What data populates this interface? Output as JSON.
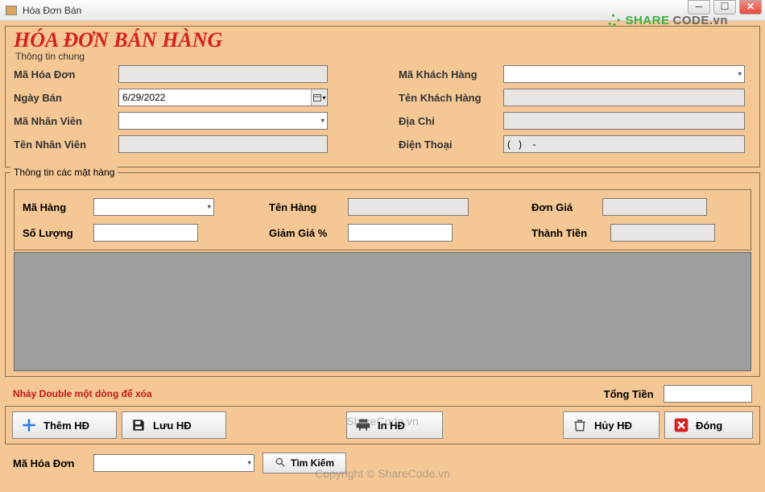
{
  "window": {
    "title": "Hóa Đơn Bán"
  },
  "brand": {
    "green": "SHARE",
    "gray": "CODE.vn"
  },
  "header": {
    "title": "HÓA ĐƠN BÁN HÀNG",
    "group_legend": "Thông tin chung"
  },
  "general": {
    "invoice_id_label": "Mã Hóa Đơn",
    "invoice_id_value": "",
    "sale_date_label": "Ngày Bán",
    "sale_date_value": "6/29/2022",
    "employee_id_label": "Mã Nhân Viên",
    "employee_id_value": "",
    "employee_name_label": "Tên Nhân Viên",
    "employee_name_value": "",
    "customer_id_label": "Mã Khách Hàng",
    "customer_id_value": "",
    "customer_name_label": "Tên Khách Hàng",
    "customer_name_value": "",
    "address_label": "Địa Chỉ",
    "address_value": "",
    "phone_label": "Điện Thoại",
    "phone_value": "(   )    -"
  },
  "items_group": {
    "legend": "Thông tin các mặt hàng",
    "product_id_label": "Mã Hàng",
    "product_id_value": "",
    "product_name_label": "Tên Hàng",
    "product_name_value": "",
    "unit_price_label": "Đơn Giá",
    "unit_price_value": "",
    "quantity_label": "Số Lượng",
    "quantity_value": "",
    "discount_label": "Giảm Giá %",
    "discount_value": "",
    "total_line_label": "Thành Tiền",
    "total_line_value": ""
  },
  "footer": {
    "hint": "Nháy Double một dòng để xóa",
    "total_label": "Tổng Tiền",
    "total_value": ""
  },
  "toolbar": {
    "add_label": "Thêm HĐ",
    "save_label": "Lưu HĐ",
    "print_label": "In HĐ",
    "cancel_label": "Hủy HĐ",
    "close_label": "Đóng"
  },
  "search": {
    "label": "Mã Hóa Đơn",
    "value": "",
    "button_label": "Tìm Kiếm"
  },
  "watermark": {
    "line1": "ShareCode.vn",
    "line2": "Copyright © ShareCode.vn"
  }
}
